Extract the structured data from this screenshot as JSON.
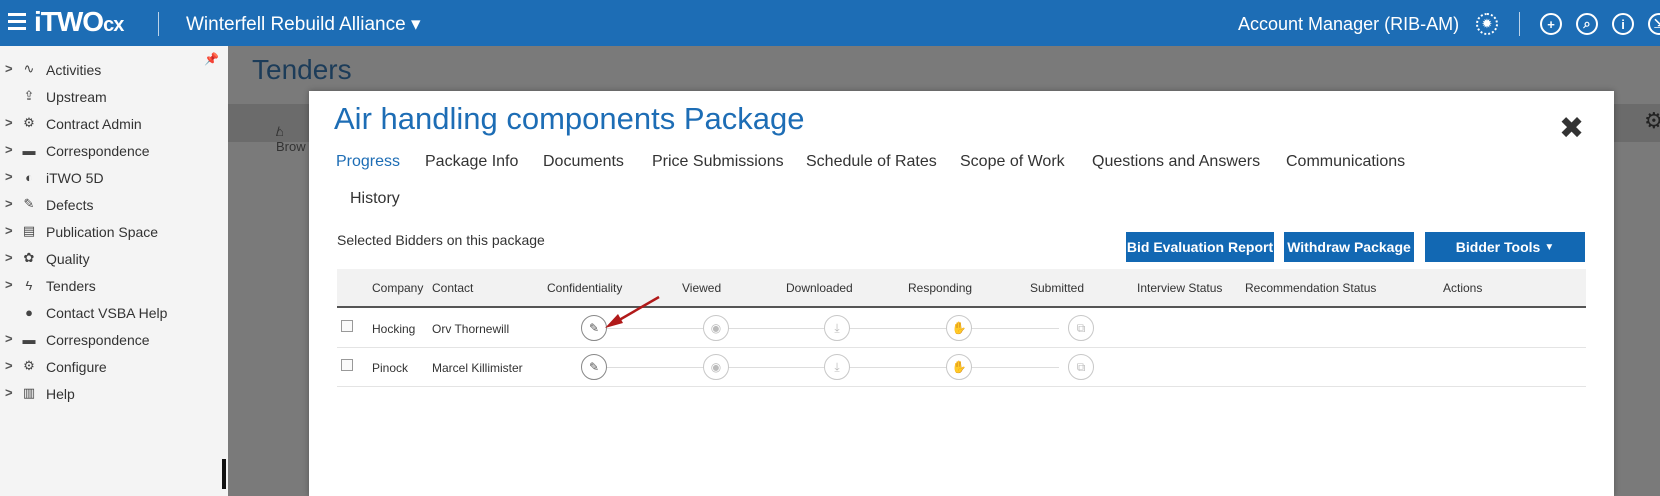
{
  "topbar": {
    "logo": "iTWO",
    "logo_suffix": "cx",
    "project": "Winterfell Rebuild Alliance ▾",
    "account": "Account Manager (RIB-AM)",
    "icons": [
      "gear-icon",
      "add-icon",
      "search-icon",
      "info-icon",
      "export-icon"
    ]
  },
  "sidebar": {
    "items": [
      {
        "label": "Activities",
        "icon": "activity-icon",
        "chevron": true
      },
      {
        "label": "Upstream",
        "icon": "upload-doc-icon",
        "chevron": false
      },
      {
        "label": "Contract Admin",
        "icon": "contract-icon",
        "chevron": true
      },
      {
        "label": "Correspondence",
        "icon": "mail-icon",
        "chevron": true
      },
      {
        "label": "iTWO 5D",
        "icon": "5d-icon",
        "chevron": true
      },
      {
        "label": "Defects",
        "icon": "defects-icon",
        "chevron": true
      },
      {
        "label": "Publication Space",
        "icon": "publication-icon",
        "chevron": true
      },
      {
        "label": "Quality",
        "icon": "quality-icon",
        "chevron": true
      },
      {
        "label": "Tenders",
        "icon": "tenders-icon",
        "chevron": true
      },
      {
        "label": "Contact VSBA Help",
        "icon": "help-chat-icon",
        "chevron": false
      },
      {
        "label": "Correspondence",
        "icon": "mail-icon",
        "chevron": true
      },
      {
        "label": "Configure",
        "icon": "configure-icon",
        "chevron": true
      },
      {
        "label": "Help",
        "icon": "book-icon",
        "chevron": true
      }
    ]
  },
  "page": {
    "title": "Tenders",
    "breadcrumb": "/ Brow"
  },
  "modal": {
    "title": "Air handling components Package",
    "tabs": [
      "Progress",
      "Package Info",
      "Documents",
      "Price Submissions",
      "Schedule of Rates",
      "Scope of Work",
      "Questions and Answers",
      "Communications",
      "History"
    ],
    "active_tab": "Progress",
    "subtitle": "Selected Bidders on this package",
    "buttons": {
      "bid_eval": "Bid Evaluation Report",
      "withdraw": "Withdraw Package",
      "bidder_tools": "Bidder Tools"
    },
    "columns": [
      "Company",
      "Contact",
      "Confidentiality",
      "Viewed",
      "Downloaded",
      "Responding",
      "Submitted",
      "Interview Status",
      "Recommendation Status",
      "Actions"
    ],
    "rows": [
      {
        "company": "Hocking",
        "contact": "Orv Thornewill"
      },
      {
        "company": "Pinock",
        "contact": "Marcel Killimister"
      }
    ]
  }
}
